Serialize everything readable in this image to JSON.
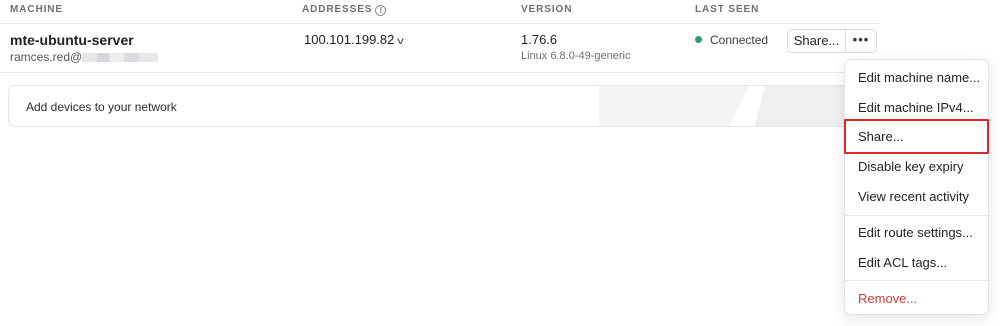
{
  "columns": {
    "machine": "MACHINE",
    "addresses": "ADDRESSES",
    "version": "VERSION",
    "last_seen": "LAST SEEN"
  },
  "row": {
    "name": "mte-ubuntu-server",
    "owner_prefix": "ramces.red@",
    "address": "100.101.199.82",
    "version": "1.76.6",
    "os": "Linux 6.8.0-49-generic",
    "status": "Connected",
    "status_color": "#2c9c70",
    "share_label": "Share...",
    "more_label": "•••"
  },
  "banner": {
    "text": "Add devices to your network"
  },
  "menu": {
    "items": [
      {
        "label": "Edit machine name..."
      },
      {
        "label": "Edit machine IPv4..."
      },
      {
        "label": "Share...",
        "highlighted": true
      },
      {
        "label": "Disable key expiry"
      },
      {
        "label": "View recent activity"
      },
      {
        "label": "Edit route settings..."
      },
      {
        "label": "Edit ACL tags..."
      },
      {
        "label": "Remove...",
        "danger": true
      }
    ]
  },
  "icons": {
    "info": "info-icon",
    "chevron": "chevron-down-icon"
  },
  "colors": {
    "highlight": "#d9262b",
    "danger": "#d23b3b"
  }
}
